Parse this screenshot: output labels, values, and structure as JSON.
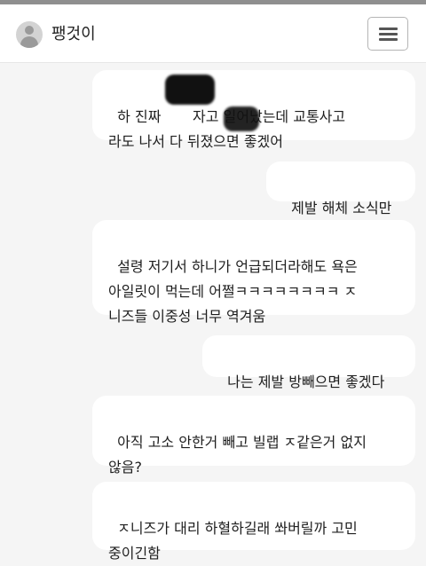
{
  "header": {
    "title": "팽것이",
    "avatar_icon": "user-avatar-icon",
    "menu_icon": "hamburger-menu-icon"
  },
  "messages": [
    {
      "text": "하 진짜       자고 일어났는데 교통사고\n라도 나서 다 뒤졌으면 좋겠어",
      "redacted": true
    },
    {
      "text": "제발 해체 소식만"
    },
    {
      "text": "설령 저기서 하니가 언급되더라해도 욕은\n아일릿이 먹는데 어쩔ㅋㅋㅋㅋㅋㅋㅋㅋ ㅈ\n니즈들 이중성 너무 역겨움"
    },
    {
      "text": "나는 제발 방빼으면 좋겠다"
    },
    {
      "text": "아직 고소 안한거 빼고 빌랩 ㅈ같은거 없지\n않음?"
    },
    {
      "text": "ㅈ니즈가 대리 하혈하길래 쏴버릴까 고민\n중이긴함"
    }
  ],
  "colors": {
    "background": "#f5f5f5",
    "bubble": "#ffffff",
    "text": "#1e1e1e"
  }
}
